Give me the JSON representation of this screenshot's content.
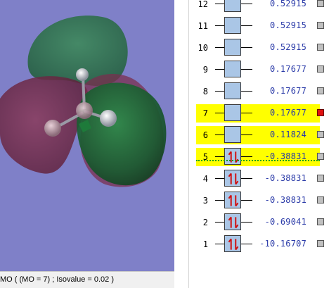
{
  "status": {
    "text": "MO ( (MO = 7) ; Isovalue = 0.02 )"
  },
  "colors": {
    "viewport_bg": "#7f80c8",
    "orbital_positive": "#1f6b3a",
    "orbital_negative": "#7a2a4a",
    "orbital_box": "#aac6e6",
    "energy_text": "#2a3aa8",
    "highlight": "#ffff00",
    "selected_indicator": "#e01010",
    "homo_lumo_separator": "#19a019"
  },
  "mo_levels": [
    {
      "number": "12",
      "energy": "0.52915",
      "occupied": false,
      "highlighted": false,
      "selected": false
    },
    {
      "number": "11",
      "energy": "0.52915",
      "occupied": false,
      "highlighted": false,
      "selected": false
    },
    {
      "number": "10",
      "energy": "0.52915",
      "occupied": false,
      "highlighted": false,
      "selected": false
    },
    {
      "number": "9",
      "energy": "0.17677",
      "occupied": false,
      "highlighted": false,
      "selected": false
    },
    {
      "number": "8",
      "energy": "0.17677",
      "occupied": false,
      "highlighted": false,
      "selected": false
    },
    {
      "number": "7",
      "energy": "0.17677",
      "occupied": false,
      "highlighted": true,
      "selected": true
    },
    {
      "number": "6",
      "energy": "0.11824",
      "occupied": false,
      "highlighted": true,
      "selected": false
    },
    {
      "number": "5",
      "energy": "-0.38831",
      "occupied": true,
      "highlighted": true,
      "selected": false
    },
    {
      "number": "4",
      "energy": "-0.38831",
      "occupied": true,
      "highlighted": false,
      "selected": false
    },
    {
      "number": "3",
      "energy": "-0.38831",
      "occupied": true,
      "highlighted": false,
      "selected": false
    },
    {
      "number": "2",
      "energy": "-0.69041",
      "occupied": true,
      "highlighted": false,
      "selected": false
    },
    {
      "number": "1",
      "energy": "-10.16707",
      "occupied": true,
      "highlighted": false,
      "selected": false
    }
  ]
}
